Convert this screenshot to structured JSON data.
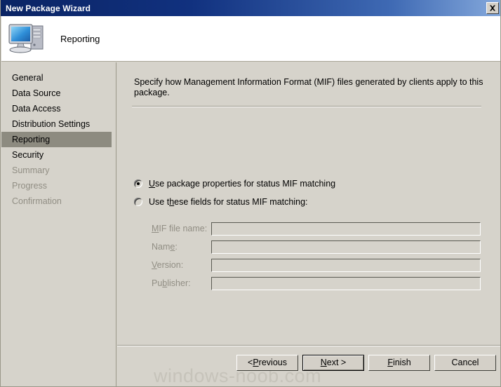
{
  "window": {
    "title": "New Package Wizard",
    "close_icon": "close-x-icon"
  },
  "header": {
    "title": "Reporting",
    "icon": "computer-monitor-icon"
  },
  "sidebar": {
    "items": [
      {
        "label": "General",
        "state": "done"
      },
      {
        "label": "Data Source",
        "state": "done"
      },
      {
        "label": "Data Access",
        "state": "done"
      },
      {
        "label": "Distribution Settings",
        "state": "done"
      },
      {
        "label": "Reporting",
        "state": "active"
      },
      {
        "label": "Security",
        "state": "done"
      },
      {
        "label": "Summary",
        "state": "disabled"
      },
      {
        "label": "Progress",
        "state": "disabled"
      },
      {
        "label": "Confirmation",
        "state": "disabled"
      }
    ]
  },
  "main": {
    "intro": "Specify how Management Information Format (MIF) files generated by clients apply to this package.",
    "radios": [
      {
        "prefix": "",
        "accel": "U",
        "suffix": "se package properties for status MIF matching",
        "selected": true
      },
      {
        "prefix": "Use t",
        "accel": "h",
        "suffix": "ese fields for status MIF matching:",
        "selected": false
      }
    ],
    "fields": [
      {
        "accel": "M",
        "prefix": "",
        "suffix": "IF file name:",
        "value": "",
        "enabled": false
      },
      {
        "accel": "e",
        "prefix": "Nam",
        "suffix": ":",
        "value": "",
        "enabled": false
      },
      {
        "accel": "V",
        "prefix": "",
        "suffix": "ersion:",
        "value": "",
        "enabled": false
      },
      {
        "accel": "b",
        "prefix": "Pu",
        "suffix": "lisher:",
        "value": "",
        "enabled": false
      }
    ]
  },
  "buttons": {
    "previous": {
      "prefix": "< ",
      "accel": "P",
      "suffix": "revious"
    },
    "next": {
      "prefix": "",
      "accel": "N",
      "suffix": "ext >"
    },
    "finish": {
      "prefix": "",
      "accel": "F",
      "suffix": "inish"
    },
    "cancel": {
      "prefix": "",
      "accel": "",
      "suffix": "Cancel"
    }
  },
  "watermark": {
    "text": "windows-noob.com"
  },
  "colors": {
    "title_bar_start": "#0a2464",
    "title_bar_end": "#85a9dc",
    "dialog_face": "#d6d3cb",
    "header_face": "#ffffff",
    "nav_active": "#8d8b80",
    "disabled_text": "#918e84",
    "watermark": "#c6c3ba"
  }
}
